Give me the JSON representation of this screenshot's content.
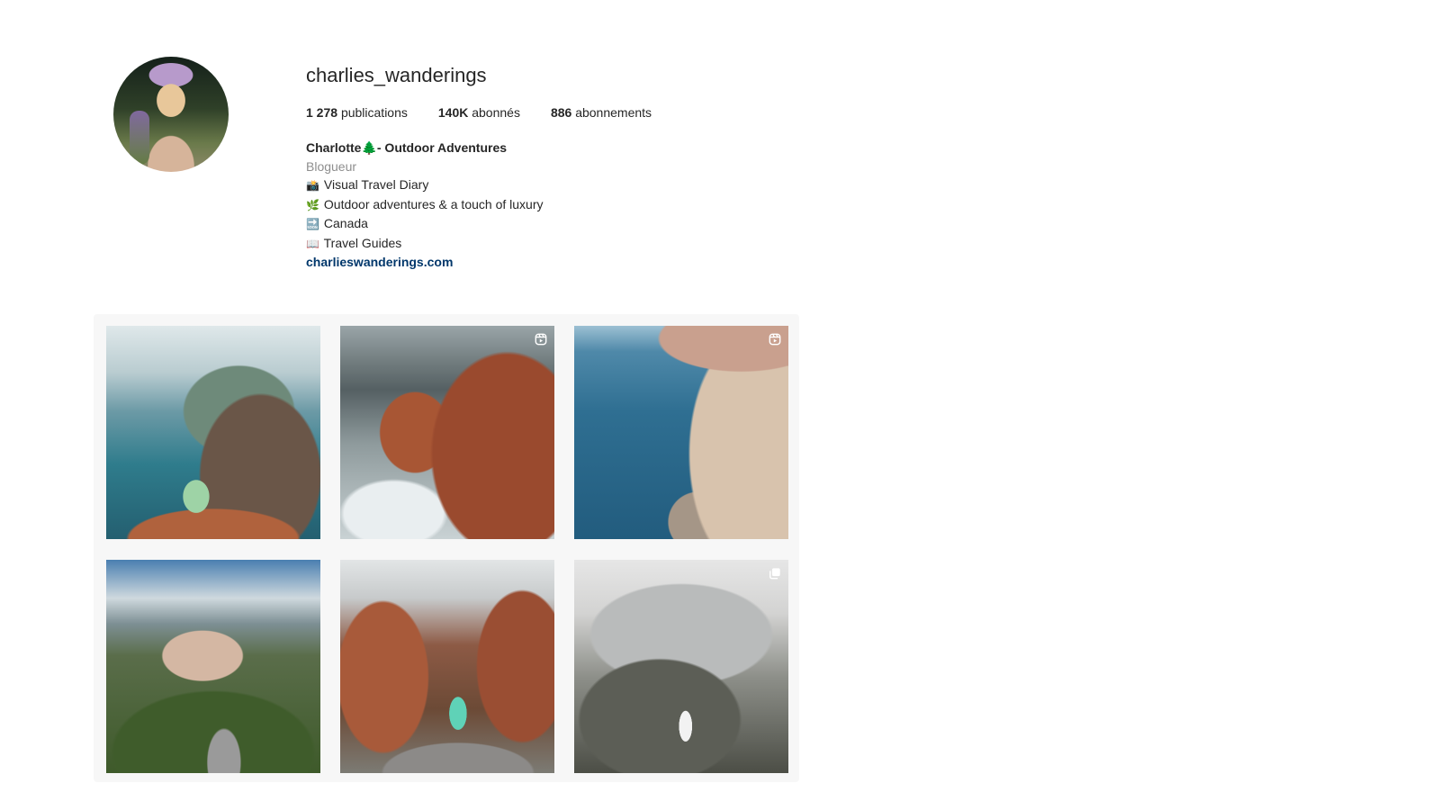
{
  "profile": {
    "username": "charlies_wanderings",
    "stats": {
      "posts_count": "1 278",
      "posts_label": "publications",
      "followers_count": "140K",
      "followers_label": "abonnés",
      "following_count": "886",
      "following_label": "abonnements"
    },
    "bio": {
      "name": "Charlotte🌲- Outdoor Adventures",
      "category": "Blogueur",
      "lines": [
        {
          "emoji": "📸",
          "text": "Visual Travel Diary"
        },
        {
          "emoji": "🌿",
          "text": "Outdoor adventures & a touch of luxury"
        },
        {
          "emoji": "🔜",
          "text": "Canada"
        },
        {
          "emoji": "📖",
          "text": "Travel Guides"
        }
      ],
      "website": "charlieswanderings.com"
    }
  },
  "posts": [
    {
      "subject": "coastal-cliff-overlook",
      "icon": "none"
    },
    {
      "subject": "red-rocks-sea-tower",
      "icon": "reel-icon"
    },
    {
      "subject": "cliffside-town",
      "icon": "reel-icon"
    },
    {
      "subject": "mountain-village-road",
      "icon": "none"
    },
    {
      "subject": "red-rock-canyon-road",
      "icon": "none"
    },
    {
      "subject": "misty-mountain-hike",
      "icon": "carousel-icon"
    }
  ],
  "colors": {
    "text": "#262626",
    "muted": "#8e8e8e",
    "link": "#00376b",
    "grid_background": "#f7f7f7"
  }
}
